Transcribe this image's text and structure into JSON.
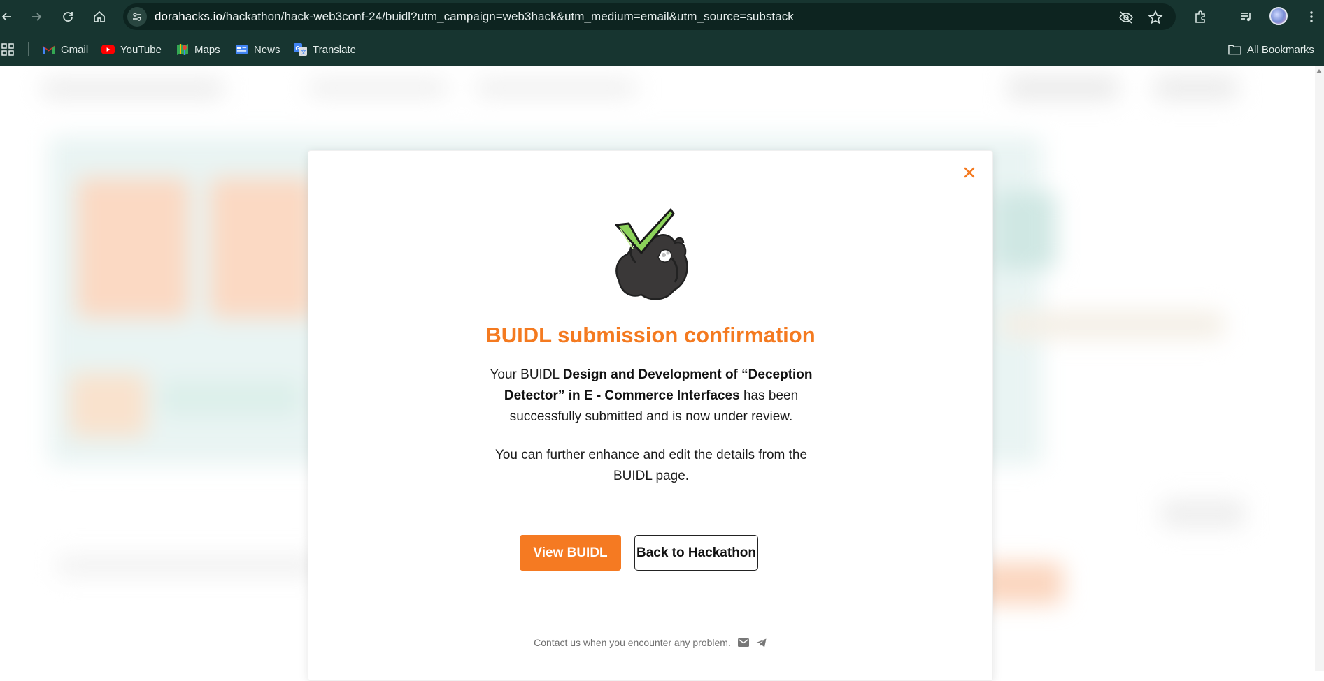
{
  "browser": {
    "url_host": "dorahacks.io",
    "url_path": "/hackathon/hack-web3conf-24/buidl?utm_campaign=web3hack&utm_medium=email&utm_source=substack",
    "bookmarks": [
      {
        "label": "Gmail",
        "icon": "gmail-icon"
      },
      {
        "label": "YouTube",
        "icon": "youtube-icon"
      },
      {
        "label": "Maps",
        "icon": "maps-icon"
      },
      {
        "label": "News",
        "icon": "news-icon"
      },
      {
        "label": "Translate",
        "icon": "translate-icon"
      }
    ],
    "all_bookmarks_label": "All Bookmarks"
  },
  "modal": {
    "title": "BUIDL submission confirmation",
    "message_prefix": "Your BUIDL ",
    "buidl_name": "Design and Development of “Deception Detector” in E - Commerce Interfaces",
    "message_suffix": " has been successfully submitted and is now under review.",
    "message_2": "You can further enhance and edit the details from the BUIDL page.",
    "view_button": "View BUIDL",
    "back_button": "Back to Hackathon",
    "contact_text": "Contact us when you encounter any problem.",
    "contact_icons": [
      "mail-icon",
      "telegram-icon"
    ]
  },
  "colors": {
    "chrome_bg": "#173530",
    "accent": "#f57a22",
    "title_orange": "#f47a20"
  }
}
